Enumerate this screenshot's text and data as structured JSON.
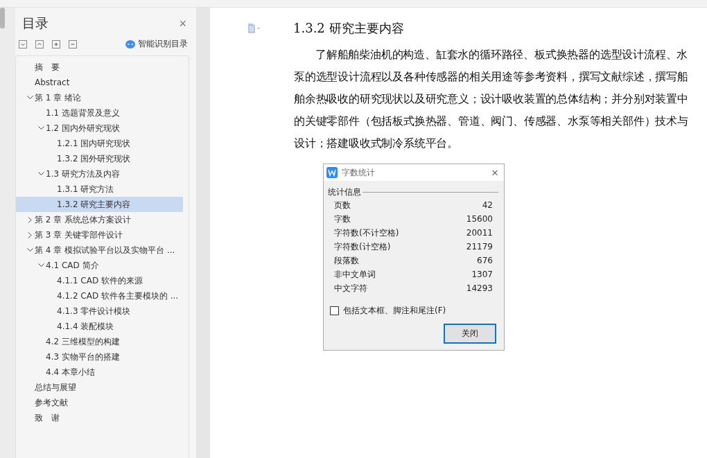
{
  "sidebar": {
    "title": "目录",
    "close": "×",
    "smart_button": "智能识别目录",
    "items": [
      {
        "label": "摘　要",
        "selected": false
      },
      {
        "label": "Abstract",
        "selected": false
      },
      {
        "label": "第 1 章  绪论",
        "selected": false,
        "expanded": true,
        "children": [
          {
            "label": "1.1 选题背景及意义",
            "selected": false
          },
          {
            "label": "1.2 国内外研究现状",
            "selected": false,
            "expanded": true,
            "children": [
              {
                "label": "1.2.1 国内研究现状",
                "selected": false
              },
              {
                "label": "1.3.2 国外研究现状",
                "selected": false
              }
            ]
          },
          {
            "label": "1.3 研究方法及内容",
            "selected": false,
            "expanded": true,
            "children": [
              {
                "label": "1.3.1 研究方法",
                "selected": false
              },
              {
                "label": "1.3.2 研究主要内容",
                "selected": true
              }
            ]
          }
        ]
      },
      {
        "label": "第 2 章  系统总体方案设计",
        "selected": false,
        "expanded": false
      },
      {
        "label": "第 3 章  关键零部件设计",
        "selected": false,
        "expanded": false
      },
      {
        "label": "第 4 章  模拟试验平台以及实物平台 ...",
        "selected": false,
        "expanded": true,
        "children": [
          {
            "label": "4.1 CAD 简介",
            "selected": false,
            "expanded": true,
            "children": [
              {
                "label": "4.1.1 CAD 软件的来源",
                "selected": false
              },
              {
                "label": "4.1.2 CAD 软件各主要模块的 ...",
                "selected": false
              },
              {
                "label": "4.1.3 零件设计模块",
                "selected": false
              },
              {
                "label": "4.1.4 装配模块",
                "selected": false
              }
            ]
          },
          {
            "label": "4.2 三维模型的构建",
            "selected": false
          },
          {
            "label": "4.3 实物平台的搭建",
            "selected": false
          },
          {
            "label": "4.4 本章小结",
            "selected": false
          }
        ]
      },
      {
        "label": "总结与展望",
        "selected": false
      },
      {
        "label": "参考文献",
        "selected": false
      },
      {
        "label": "致　谢",
        "selected": false
      }
    ]
  },
  "document": {
    "heading": "1.3.2 研究主要内容",
    "paragraph": "了解船舶柴油机的构造、缸套水的循环路径、板式换热器的选型设计流程、水泵的选型设计流程以及各种传感器的相关用途等参考资料，撰写文献综述，撰写船舶余热吸收的研究现状以及研究意义；设计吸收装置的总体结构；并分别对装置中的关键零部件（包括板式换热器、管道、阀门、传感器、水泵等相关部件）技术与设计；搭建吸收式制冷系统平台。"
  },
  "dialog": {
    "title": "字数统计",
    "close": "×",
    "group": "统计信息",
    "stats": [
      {
        "label": "页数",
        "value": "42"
      },
      {
        "label": "字数",
        "value": "15600"
      },
      {
        "label": "字符数(不计空格)",
        "value": "20011"
      },
      {
        "label": "字符数(计空格)",
        "value": "21179"
      },
      {
        "label": "段落数",
        "value": "676"
      },
      {
        "label": "非中文单词",
        "value": "1307"
      },
      {
        "label": "中文字符",
        "value": "14293"
      }
    ],
    "checkbox": {
      "label": "包括文本框、脚注和尾注(F)",
      "checked": false
    },
    "button": "关闭"
  }
}
